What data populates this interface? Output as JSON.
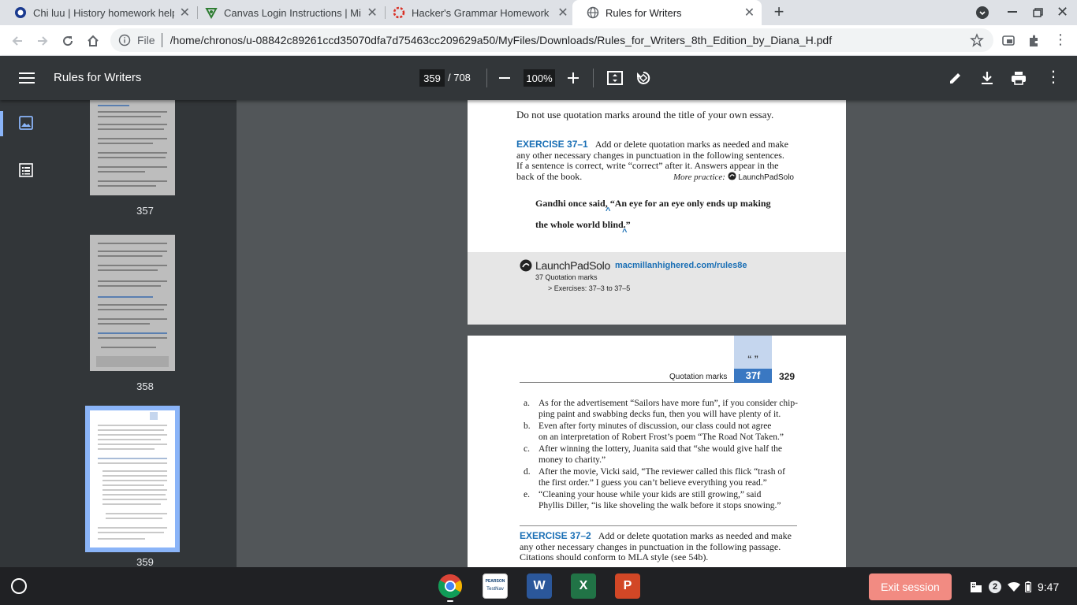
{
  "browser": {
    "tabs": [
      {
        "title": "Chi luu | History homework help",
        "active": false
      },
      {
        "title": "Canvas Login Instructions | Miss",
        "active": false
      },
      {
        "title": "Hacker's Grammar Homework II",
        "active": false
      },
      {
        "title": "Rules for Writers",
        "active": true
      }
    ],
    "new_tab": "+",
    "omnibox": {
      "scheme": "File",
      "url": "/home/chronos/u-08842c89261ccd35070dfa7d75463cc209629a50/MyFiles/Downloads/Rules_for_Writers_8th_Edition_by_Diana_H.pdf"
    }
  },
  "pdf": {
    "title": "Rules for Writers",
    "page_current": "359",
    "page_total": "/ 708",
    "zoom": "100%",
    "thumbnails": [
      {
        "label": "357"
      },
      {
        "label": "358"
      },
      {
        "label": "359"
      }
    ]
  },
  "page_top": {
    "line_title": "Do not use quotation marks around the title of your own essay.",
    "exercise_label": "EXERCISE 37–1",
    "exercise_lines": [
      "Add or delete quotation marks as needed and make",
      "any other necessary changes in punctuation in the following sentences.",
      "If a sentence is correct, write “correct” after it. Answers appear in the",
      "back of the book."
    ],
    "more_practice": "More practice:",
    "launchpad": "LaunchPadSolo",
    "example_line1": "Gandhi once said, “An eye for an eye only ends up making",
    "example_line2": "the whole world blind.”",
    "banner_link": "macmillanhighered.com/rules8e",
    "banner_line1": "37  Quotation marks",
    "banner_line2": "> Exercises: 37–3 to 37–5"
  },
  "page_bottom": {
    "quote_glyph": "“ ”",
    "section_label": "Quotation marks",
    "section_tab": "37f",
    "page_number": "329",
    "items": [
      {
        "letter": "a.",
        "lines": [
          "As for the advertisement “Sailors have more fun”, if you consider chip-",
          "ping paint and swabbing decks fun, then you will have plenty of it."
        ]
      },
      {
        "letter": "b.",
        "lines": [
          "Even after forty minutes of discussion, our class could not agree",
          "on an interpretation of Robert Frost’s poem “The Road Not Taken.”"
        ]
      },
      {
        "letter": "c.",
        "lines": [
          "After winning the lottery, Juanita said that “she would give half the",
          "money to charity.”"
        ]
      },
      {
        "letter": "d.",
        "lines": [
          "After the movie, Vicki said, “The reviewer called this flick “trash of",
          "the first order.” I guess you can’t believe everything you read.”"
        ]
      },
      {
        "letter": "e.",
        "lines": [
          "“Cleaning your house while your kids are still growing,” said",
          "Phyllis Diller, “is like shoveling the walk before it stops snowing.”"
        ]
      }
    ],
    "exercise_label": "EXERCISE 37–2",
    "exercise_lines": [
      "Add or delete quotation marks as needed and make",
      "any other necessary changes in punctuation in the following passage.",
      "Citations should conform to MLA style (see 54b)."
    ]
  },
  "shelf": {
    "exit_session": "Exit session",
    "notifications": "2",
    "time": "9:47",
    "app_labels": {
      "pearson_line1": "PEARSON",
      "pearson_line2": "TestNav",
      "word": "W",
      "excel": "X",
      "powerpoint": "P"
    }
  },
  "colors": {
    "accent_blue": "#1a6fb5",
    "exit_button": "#f28b82"
  }
}
